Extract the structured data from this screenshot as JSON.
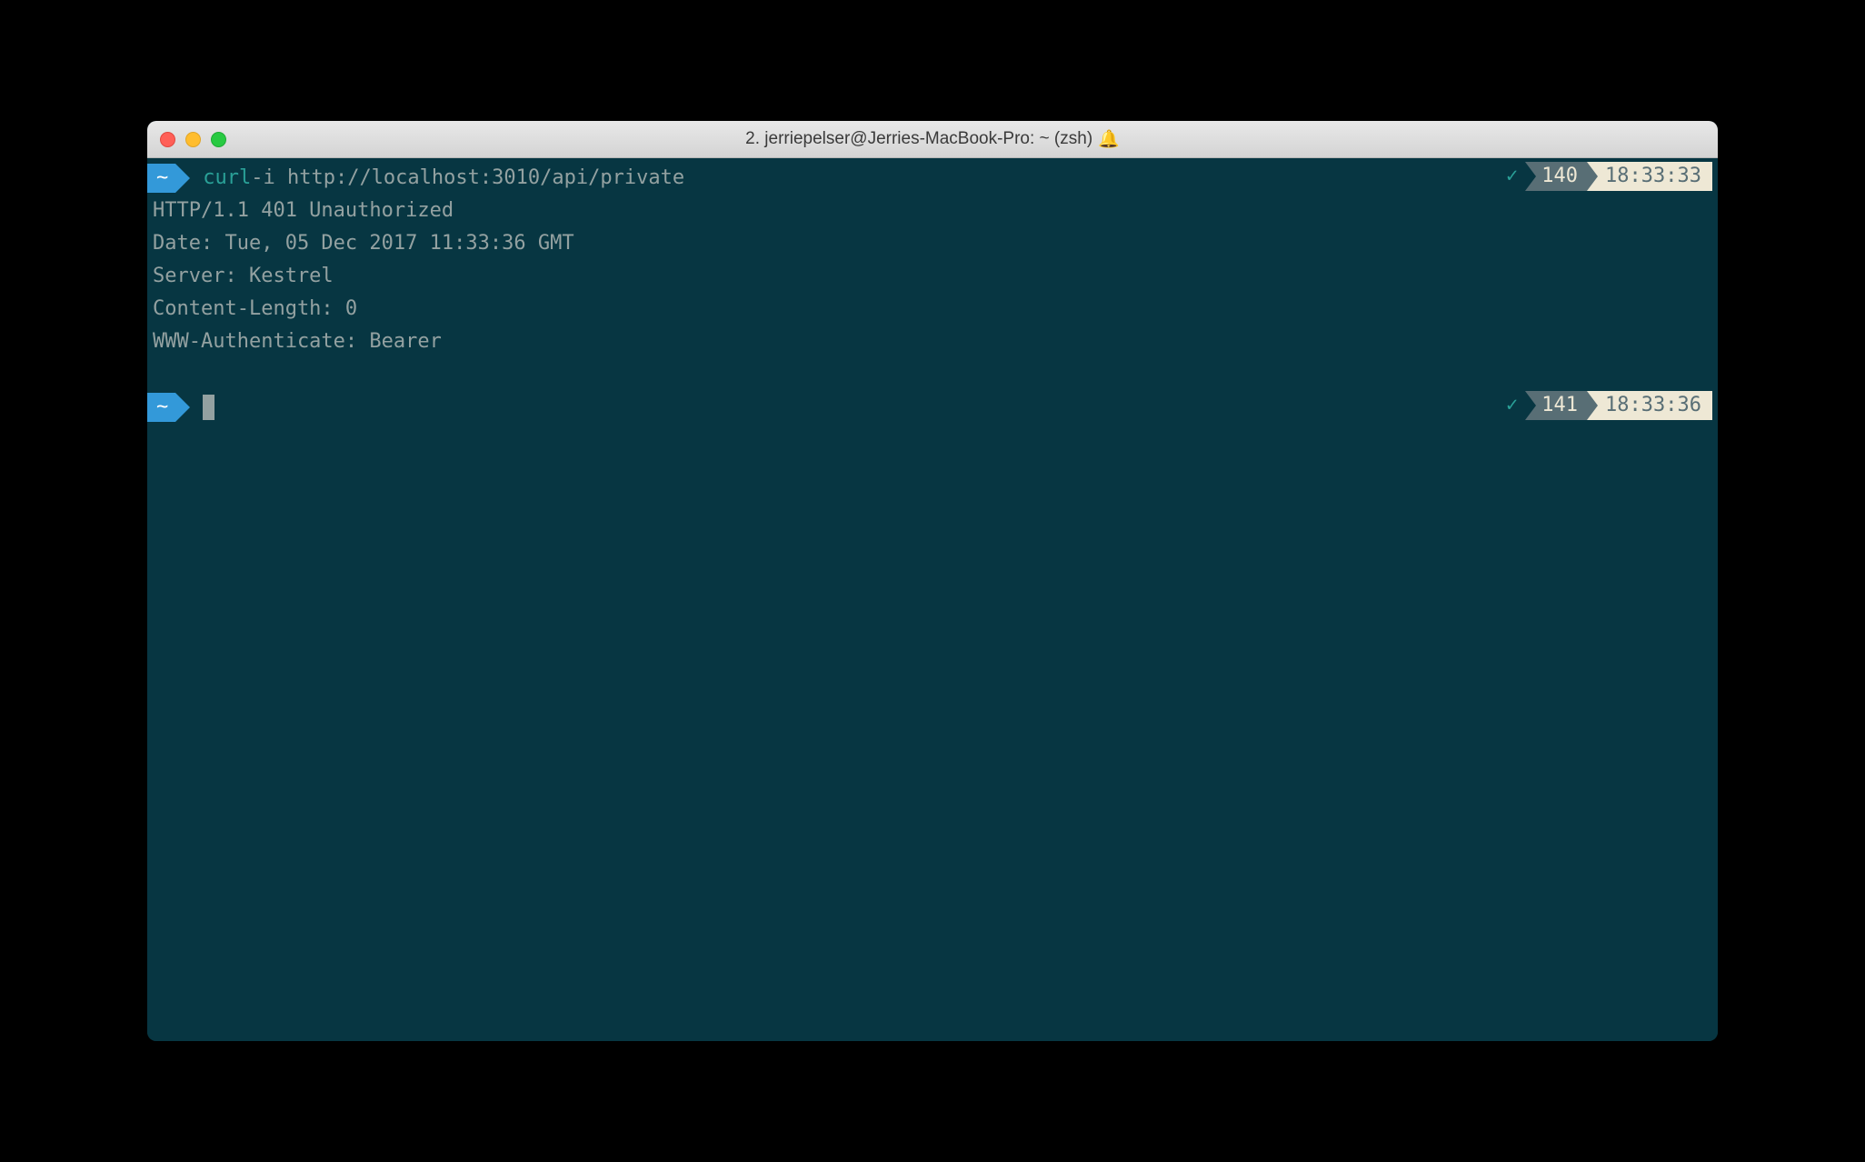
{
  "window": {
    "title": "2. jerriepelser@Jerries-MacBook-Pro: ~ (zsh)",
    "bell_icon": "🔔"
  },
  "prompt1": {
    "home": "~",
    "cmd_name": "curl",
    "cmd_args": " -i http://localhost:3010/api/private",
    "status_check": "✓",
    "status_num": "140",
    "status_time": "18:33:33"
  },
  "output": {
    "line1": "HTTP/1.1 401 Unauthorized",
    "line2": "Date: Tue, 05 Dec 2017 11:33:36 GMT",
    "line3": "Server: Kestrel",
    "line4": "Content-Length: 0",
    "line5": "WWW-Authenticate: Bearer"
  },
  "prompt2": {
    "home": "~",
    "status_check": "✓",
    "status_num": "141",
    "status_time": "18:33:36"
  }
}
